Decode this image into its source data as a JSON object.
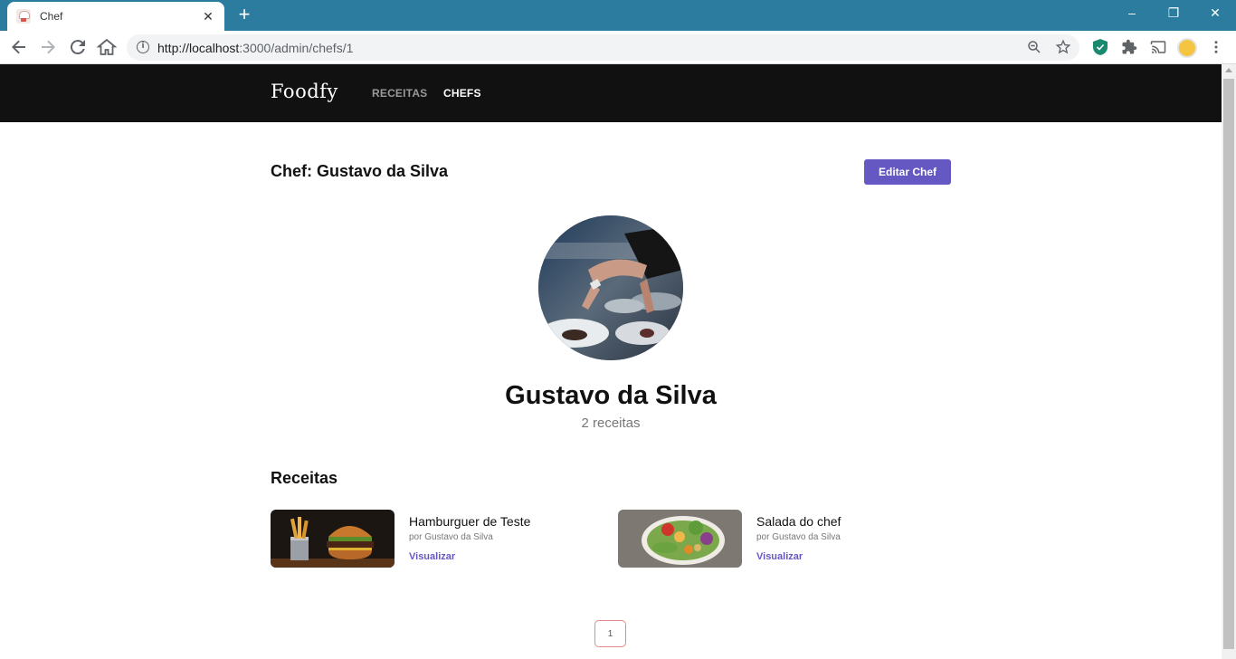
{
  "browser": {
    "tab_title": "Chef",
    "tab_close": "✕",
    "new_tab": "+",
    "url_host": "http://localhost",
    "url_path": ":3000/admin/chefs/1",
    "window_controls": [
      "–",
      "❐",
      "✕"
    ]
  },
  "site": {
    "logo": "Foodfy",
    "nav": [
      {
        "label": "RECEITAS",
        "active": false
      },
      {
        "label": "CHEFS",
        "active": true
      }
    ]
  },
  "page": {
    "heading": "Chef: Gustavo da Silva",
    "edit_button": "Editar Chef",
    "chef_name": "Gustavo da Silva",
    "recipe_count": "2 receitas",
    "section_title": "Receitas"
  },
  "recipes": [
    {
      "title": "Hamburguer de Teste",
      "author": "por Gustavo da Silva",
      "link": "Visualizar"
    },
    {
      "title": "Salada do chef",
      "author": "por Gustavo da Silva",
      "link": "Visualizar"
    }
  ],
  "pagination": {
    "current": "1"
  },
  "colors": {
    "tabbar": "#2c7c9f",
    "header": "#111111",
    "accent": "#6558c3"
  }
}
